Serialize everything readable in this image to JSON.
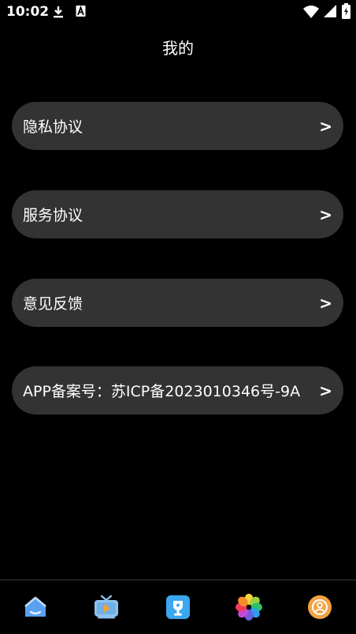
{
  "status_bar": {
    "time": "10:02"
  },
  "header": {
    "title": "我的"
  },
  "menu": {
    "items": [
      {
        "label": "隐私协议",
        "arrow": ">"
      },
      {
        "label": "服务协议",
        "arrow": ">"
      },
      {
        "label": "意见反馈",
        "arrow": ">"
      },
      {
        "label": "APP备案号：苏ICP备2023010346号-9A",
        "arrow": ">"
      }
    ]
  },
  "tab_bar": {
    "tabs": [
      {
        "icon": "home-icon"
      },
      {
        "icon": "tv-play-icon"
      },
      {
        "icon": "trophy-icon"
      },
      {
        "icon": "flower-icon"
      },
      {
        "icon": "profile-icon"
      }
    ]
  }
}
